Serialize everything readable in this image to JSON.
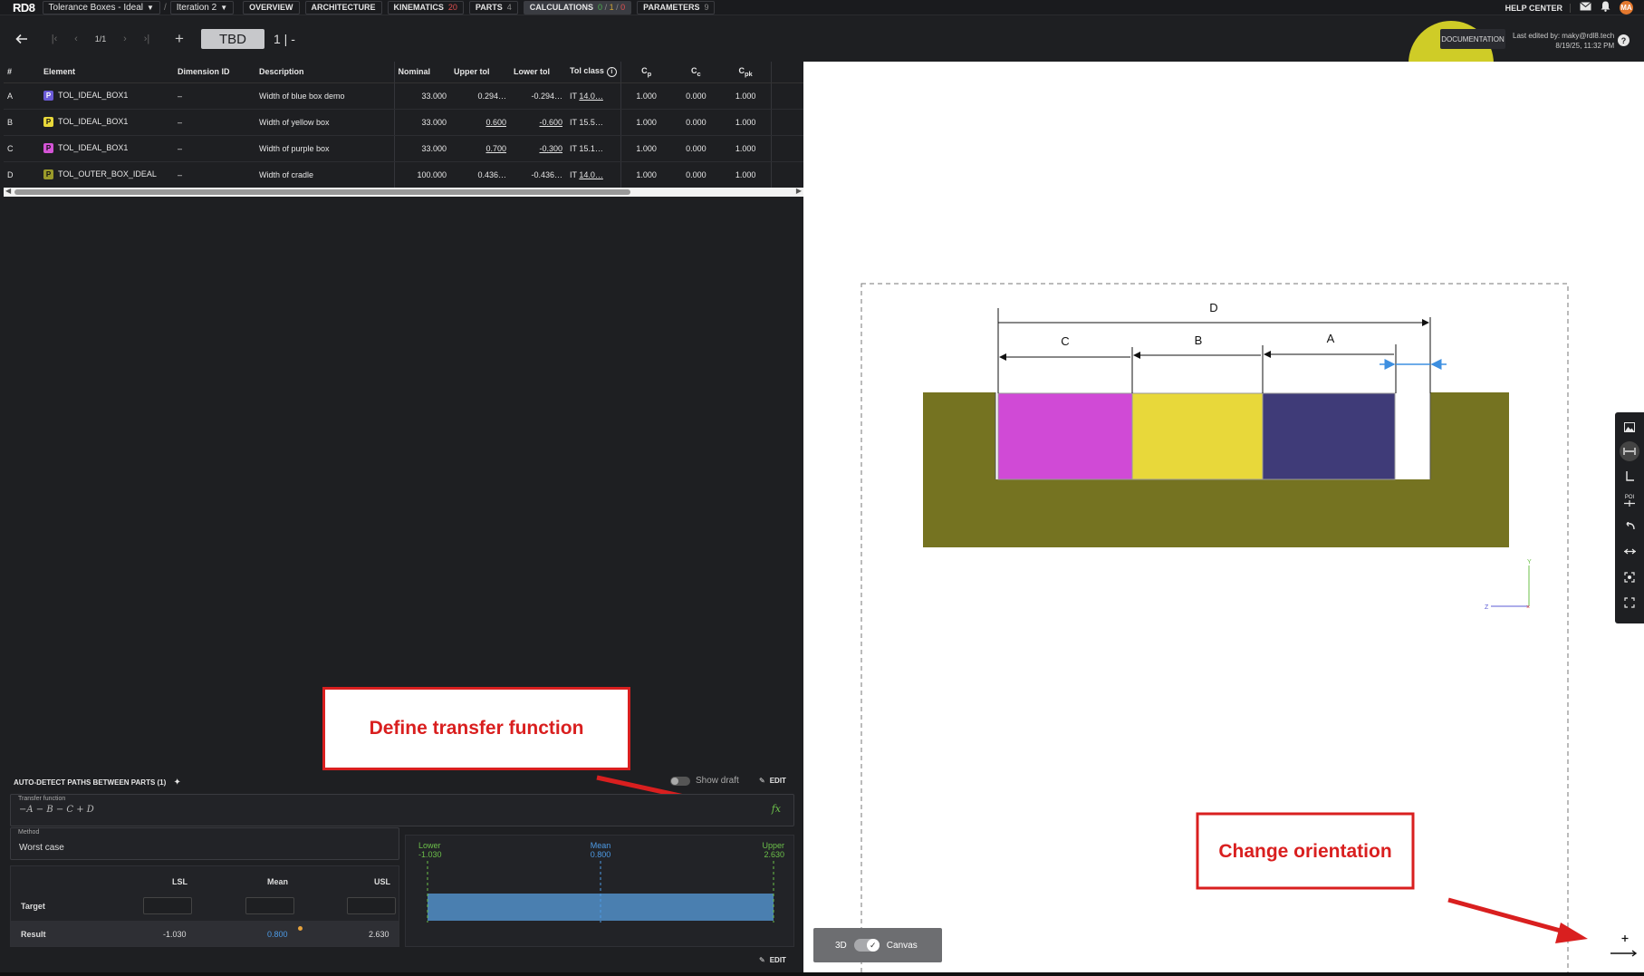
{
  "topbar": {
    "logo": "RD8",
    "project": "Tolerance Boxes - Ideal",
    "iteration": "Iteration 2",
    "tabs": [
      {
        "label": "OVERVIEW",
        "count": ""
      },
      {
        "label": "ARCHITECTURE",
        "count": ""
      },
      {
        "label": "KINEMATICS",
        "count": "20"
      },
      {
        "label": "PARTS",
        "count": "4"
      },
      {
        "label": "PARAMETERS",
        "count": "9"
      }
    ],
    "calc_tab": {
      "label": "CALCULATIONS",
      "ok": "0",
      "warn": "1",
      "err": "0"
    },
    "help": "HELP CENTER",
    "avatar": "MA"
  },
  "toolbar": {
    "page": "1/1",
    "status": "TBD",
    "revision": "1 | -",
    "documentation": "DOCUMENTATION",
    "edited_line1": "Last edited by: maky@rdl8.tech",
    "edited_line2": "8/19/25, 11:32 PM"
  },
  "table": {
    "headers": {
      "idx": "#",
      "element": "Element",
      "dimid": "Dimension ID",
      "desc": "Description",
      "nominal": "Nominal",
      "upper": "Upper tol",
      "lower": "Lower tol",
      "tolclass": "Tol class",
      "cp": "C",
      "cp_sub": "p",
      "cc": "C",
      "cc_sub": "c",
      "cpk": "C",
      "cpk_sub": "pk"
    },
    "rows": [
      {
        "idx": "A",
        "badge": "P",
        "badge_color": "#6b5bd6",
        "element": "TOL_IDEAL_BOX1",
        "dimid": "–",
        "desc": "Width of blue box demo",
        "nominal": "33.000",
        "upper": "0.294…",
        "lower": "-0.294…",
        "tolclass_prefix": "IT ",
        "tolclass": "14.0…",
        "cp": "1.000",
        "cc": "0.000",
        "cpk": "1.000"
      },
      {
        "idx": "B",
        "badge": "P",
        "badge_color": "#e8d83a",
        "element": "TOL_IDEAL_BOX1",
        "dimid": "–",
        "desc": "Width of yellow box",
        "nominal": "33.000",
        "upper": "0.600",
        "lower": "-0.600",
        "tolclass_prefix": "IT ",
        "tolclass": "15.5…",
        "cp": "1.000",
        "cc": "0.000",
        "cpk": "1.000"
      },
      {
        "idx": "C",
        "badge": "P",
        "badge_color": "#d454d6",
        "element": "TOL_IDEAL_BOX1",
        "dimid": "–",
        "desc": "Width of purple box",
        "nominal": "33.000",
        "upper": "0.700",
        "lower": "-0.300",
        "tolclass_prefix": "IT ",
        "tolclass": "15.1…",
        "cp": "1.000",
        "cc": "0.000",
        "cpk": "1.000"
      },
      {
        "idx": "D",
        "badge": "P",
        "badge_color": "#9a9a2a",
        "element": "TOL_OUTER_BOX_IDEAL",
        "dimid": "–",
        "desc": "Width of cradle",
        "nominal": "100.000",
        "upper": "0.436…",
        "lower": "-0.436…",
        "tolclass_prefix": "IT ",
        "tolclass": "14.0…",
        "cp": "1.000",
        "cc": "0.000",
        "cpk": "1.000"
      }
    ]
  },
  "annotations": {
    "transfer": "Define transfer function",
    "orientation": "Change orientation",
    "color": "#d91f1f"
  },
  "panel": {
    "autodetect": "AUTO-DETECT PATHS BETWEEN PARTS (1)",
    "show_draft": "Show draft",
    "edit": "EDIT",
    "tf_label": "Transfer function",
    "tf_value": "−A − B − C + D",
    "fx": "fx",
    "method_label": "Method",
    "method_value": "Worst case",
    "lsl": "LSL",
    "mean": "Mean",
    "usl": "USL",
    "target": "Target",
    "result": "Result",
    "result_lsl": "-1.030",
    "result_mean": "0.800",
    "result_usl": "2.630"
  },
  "chart_data": {
    "type": "area",
    "lower_label": "Lower",
    "lower_value": "-1.030",
    "mean_label": "Mean",
    "mean_value": "0.800",
    "upper_label": "Upper",
    "upper_value": "2.630",
    "range": [
      -1.03,
      2.63
    ],
    "mean": 0.8,
    "colors": {
      "fill": "#4a7fb0",
      "lower": "#6cc04a",
      "mean": "#4d9be6",
      "upper": "#6cc04a"
    }
  },
  "drawing": {
    "labels": {
      "d": "D",
      "c": "C",
      "b": "B",
      "a": "A"
    },
    "axis_y": "Y",
    "axis_z": "Z",
    "colors": {
      "cradle": "#757321",
      "purple": "#d04ad6",
      "yellow": "#e8d83a",
      "blue": "#3f3b78"
    }
  },
  "canvas_mode": {
    "left": "3D",
    "right": "Canvas"
  },
  "viewtools": {
    "poi": "POI"
  }
}
